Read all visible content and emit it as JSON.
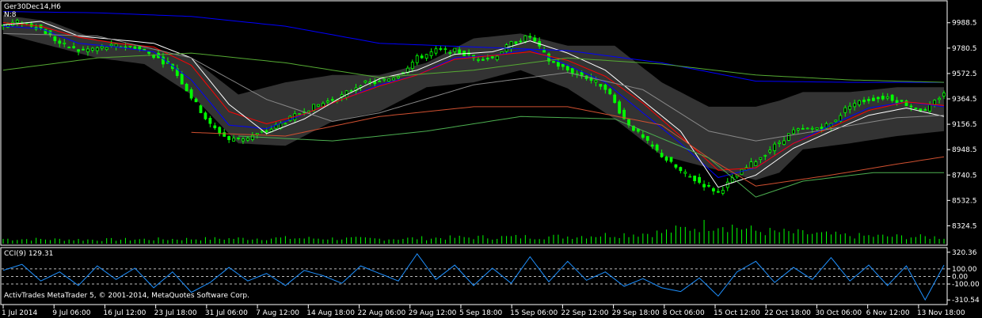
{
  "window": {
    "symbol_period": "Ger30Dec14,H6",
    "n_label": "N:8"
  },
  "footer": {
    "copyright": "ActivTrades MetaTrader 5, © 2001-2014, MetaQuotes Software Corp."
  },
  "colors": {
    "background": "#000000",
    "frame": "#ffffff",
    "candle": "#00ff00",
    "volume": "#00ff00",
    "fast_ma": "#0000ff",
    "red_ma": "#ff0000",
    "white_line": "#ffffff",
    "long_ma": "#1e90ff",
    "band": "#333333",
    "cci_line": "#1e90ff"
  },
  "chart_data": [
    {
      "type": "candlestick",
      "title": "Ger30Dec14,H6",
      "ylim": [
        8230,
        10110
      ],
      "y_tick_labels": [
        "9988.5",
        "9780.5",
        "9572.5",
        "9364.5",
        "9156.5",
        "8948.5",
        "8740.5",
        "8532.5",
        "8324.5"
      ],
      "x_tick_labels": [
        "1 Jul 2014",
        "9 Jul 06:00",
        "16 Jul 12:00",
        "23 Jul 18:00",
        "31 Jul 06:00",
        "7 Aug 12:00",
        "14 Aug 18:00",
        "22 Aug 06:00",
        "29 Aug 12:00",
        "5 Sep 18:00",
        "15 Sep 06:00",
        "22 Sep 12:00",
        "29 Sep 18:00",
        "8 Oct 06:00",
        "15 Oct 12:00",
        "22 Oct 18:00",
        "30 Oct 06:00",
        "6 Nov 12:00",
        "13 Nov 18:00"
      ],
      "close_path": [
        [
          0,
          9970
        ],
        [
          4,
          10000
        ],
        [
          8,
          9940
        ],
        [
          12,
          9820
        ],
        [
          16,
          9760
        ],
        [
          20,
          9780
        ],
        [
          24,
          9800
        ],
        [
          28,
          9790
        ],
        [
          32,
          9720
        ],
        [
          36,
          9620
        ],
        [
          40,
          9380
        ],
        [
          44,
          9150
        ],
        [
          48,
          9030
        ],
        [
          52,
          9050
        ],
        [
          56,
          9100
        ],
        [
          60,
          9180
        ],
        [
          64,
          9270
        ],
        [
          68,
          9330
        ],
        [
          72,
          9390
        ],
        [
          76,
          9490
        ],
        [
          80,
          9500
        ],
        [
          84,
          9560
        ],
        [
          88,
          9700
        ],
        [
          92,
          9760
        ],
        [
          96,
          9760
        ],
        [
          100,
          9700
        ],
        [
          104,
          9700
        ],
        [
          108,
          9820
        ],
        [
          112,
          9880
        ],
        [
          116,
          9680
        ],
        [
          120,
          9600
        ],
        [
          124,
          9540
        ],
        [
          128,
          9460
        ],
        [
          132,
          9200
        ],
        [
          136,
          9040
        ],
        [
          140,
          8900
        ],
        [
          144,
          8770
        ],
        [
          148,
          8680
        ],
        [
          152,
          8600
        ],
        [
          156,
          8740
        ],
        [
          160,
          8860
        ],
        [
          164,
          8980
        ],
        [
          168,
          9100
        ],
        [
          172,
          9120
        ],
        [
          176,
          9160
        ],
        [
          180,
          9320
        ],
        [
          184,
          9360
        ],
        [
          188,
          9380
        ],
        [
          192,
          9320
        ],
        [
          196,
          9260
        ],
        [
          200,
          9420
        ]
      ],
      "volume_path": [
        [
          0,
          6
        ],
        [
          20,
          5
        ],
        [
          40,
          6
        ],
        [
          60,
          7
        ],
        [
          80,
          6
        ],
        [
          100,
          8
        ],
        [
          120,
          9
        ],
        [
          140,
          14
        ],
        [
          148,
          22
        ],
        [
          152,
          26
        ],
        [
          160,
          16
        ],
        [
          180,
          10
        ],
        [
          200,
          8
        ]
      ],
      "series": [
        {
          "name": "fast",
          "path": [
            [
              0,
              9960
            ],
            [
              8,
              9940
            ],
            [
              16,
              9820
            ],
            [
              24,
              9790
            ],
            [
              32,
              9750
            ],
            [
              40,
              9520
            ],
            [
              48,
              9150
            ],
            [
              56,
              9120
            ],
            [
              64,
              9240
            ],
            [
              72,
              9360
            ],
            [
              80,
              9480
            ],
            [
              88,
              9560
            ],
            [
              96,
              9700
            ],
            [
              104,
              9720
            ],
            [
              112,
              9770
            ],
            [
              120,
              9640
            ],
            [
              128,
              9500
            ],
            [
              136,
              9250
            ],
            [
              144,
              9000
            ],
            [
              152,
              8720
            ],
            [
              160,
              8800
            ],
            [
              168,
              9000
            ],
            [
              176,
              9150
            ],
            [
              184,
              9290
            ],
            [
              192,
              9340
            ],
            [
              200,
              9300
            ]
          ]
        },
        {
          "name": "red",
          "path": [
            [
              0,
              9990
            ],
            [
              8,
              9960
            ],
            [
              16,
              9870
            ],
            [
              24,
              9820
            ],
            [
              32,
              9790
            ],
            [
              40,
              9640
            ],
            [
              48,
              9260
            ],
            [
              56,
              9160
            ],
            [
              64,
              9240
            ],
            [
              72,
              9360
            ],
            [
              80,
              9470
            ],
            [
              88,
              9560
            ],
            [
              96,
              9690
            ],
            [
              104,
              9720
            ],
            [
              112,
              9750
            ],
            [
              120,
              9680
            ],
            [
              128,
              9550
            ],
            [
              136,
              9330
            ],
            [
              144,
              9060
            ],
            [
              152,
              8780
            ],
            [
              160,
              8800
            ],
            [
              168,
              9000
            ],
            [
              176,
              9130
            ],
            [
              184,
              9270
            ],
            [
              192,
              9340
            ],
            [
              200,
              9310
            ]
          ]
        },
        {
          "name": "white",
          "path": [
            [
              0,
              9970
            ],
            [
              8,
              10000
            ],
            [
              16,
              9880
            ],
            [
              24,
              9850
            ],
            [
              32,
              9820
            ],
            [
              40,
              9700
            ],
            [
              48,
              9320
            ],
            [
              56,
              9080
            ],
            [
              64,
              9200
            ],
            [
              72,
              9380
            ],
            [
              80,
              9530
            ],
            [
              88,
              9600
            ],
            [
              96,
              9730
            ],
            [
              104,
              9750
            ],
            [
              112,
              9840
            ],
            [
              120,
              9740
            ],
            [
              128,
              9600
            ],
            [
              136,
              9350
            ],
            [
              144,
              9100
            ],
            [
              152,
              8640
            ],
            [
              160,
              8740
            ],
            [
              168,
              8960
            ],
            [
              176,
              9100
            ],
            [
              184,
              9230
            ],
            [
              192,
              9290
            ],
            [
              200,
              9220
            ]
          ]
        },
        {
          "name": "blue_long",
          "path": [
            [
              0,
              10080
            ],
            [
              20,
              10070
            ],
            [
              40,
              10040
            ],
            [
              60,
              9960
            ],
            [
              80,
              9820
            ],
            [
              100,
              9790
            ],
            [
              120,
              9760
            ],
            [
              140,
              9660
            ],
            [
              160,
              9510
            ],
            [
              180,
              9500
            ],
            [
              200,
              9500
            ]
          ]
        },
        {
          "name": "green_long",
          "path": [
            [
              0,
              9600
            ],
            [
              20,
              9700
            ],
            [
              40,
              9740
            ],
            [
              60,
              9660
            ],
            [
              80,
              9540
            ],
            [
              100,
              9600
            ],
            [
              120,
              9700
            ],
            [
              140,
              9650
            ],
            [
              160,
              9560
            ],
            [
              180,
              9520
            ],
            [
              200,
              9500
            ]
          ]
        },
        {
          "name": "gray_mid",
          "path": [
            [
              0,
              9900
            ],
            [
              20,
              9880
            ],
            [
              40,
              9700
            ],
            [
              56,
              9360
            ],
            [
              70,
              9180
            ],
            [
              80,
              9250
            ],
            [
              100,
              9480
            ],
            [
              120,
              9580
            ],
            [
              136,
              9440
            ],
            [
              150,
              9100
            ],
            [
              160,
              9020
            ],
            [
              176,
              9120
            ],
            [
              190,
              9210
            ],
            [
              200,
              9230
            ]
          ]
        },
        {
          "name": "red_long",
          "path": [
            [
              40,
              9090
            ],
            [
              60,
              9060
            ],
            [
              80,
              9220
            ],
            [
              100,
              9300
            ],
            [
              120,
              9300
            ],
            [
              140,
              9150
            ],
            [
              150,
              8880
            ],
            [
              160,
              8650
            ],
            [
              176,
              8740
            ],
            [
              190,
              8830
            ],
            [
              200,
              8890
            ]
          ]
        },
        {
          "name": "green_low",
          "path": [
            [
              50,
              9060
            ],
            [
              70,
              9020
            ],
            [
              90,
              9100
            ],
            [
              110,
              9220
            ],
            [
              130,
              9200
            ],
            [
              150,
              8880
            ],
            [
              160,
              8560
            ],
            [
              170,
              8690
            ],
            [
              185,
              8760
            ],
            [
              200,
              8760
            ]
          ]
        }
      ],
      "band": {
        "upper": [
          [
            0,
            10050
          ],
          [
            10,
            10000
          ],
          [
            20,
            9850
          ],
          [
            30,
            9800
          ],
          [
            40,
            9700
          ],
          [
            50,
            9400
          ],
          [
            60,
            9500
          ],
          [
            70,
            9560
          ],
          [
            80,
            9560
          ],
          [
            90,
            9660
          ],
          [
            100,
            9860
          ],
          [
            110,
            9900
          ],
          [
            120,
            9800
          ],
          [
            130,
            9800
          ],
          [
            140,
            9500
          ],
          [
            150,
            9300
          ],
          [
            160,
            9300
          ],
          [
            165,
            9350
          ],
          [
            170,
            9420
          ],
          [
            180,
            9420
          ],
          [
            190,
            9460
          ],
          [
            200,
            9460
          ]
        ],
        "lower": [
          [
            0,
            9900
          ],
          [
            10,
            9800
          ],
          [
            20,
            9700
          ],
          [
            30,
            9650
          ],
          [
            40,
            9400
          ],
          [
            50,
            9000
          ],
          [
            60,
            8980
          ],
          [
            70,
            9180
          ],
          [
            80,
            9260
          ],
          [
            90,
            9460
          ],
          [
            100,
            9500
          ],
          [
            110,
            9600
          ],
          [
            120,
            9450
          ],
          [
            130,
            9200
          ],
          [
            140,
            8900
          ],
          [
            150,
            8800
          ],
          [
            160,
            8700
          ],
          [
            165,
            8760
          ],
          [
            170,
            8950
          ],
          [
            180,
            9000
          ],
          [
            190,
            9060
          ],
          [
            200,
            9100
          ]
        ]
      }
    },
    {
      "type": "line",
      "title": "CCI(9) 129.31",
      "indicator": "CCI(9)",
      "value": 129.31,
      "ylim": [
        -340,
        350
      ],
      "y_tick_labels": [
        "320.36",
        "100.00",
        "0.00",
        "-100.00",
        "-310.54"
      ],
      "levels": [
        100,
        0,
        -100
      ],
      "path": [
        [
          0,
          80
        ],
        [
          4,
          160
        ],
        [
          8,
          -60
        ],
        [
          12,
          60
        ],
        [
          16,
          -120
        ],
        [
          20,
          140
        ],
        [
          24,
          -40
        ],
        [
          28,
          110
        ],
        [
          32,
          -150
        ],
        [
          36,
          60
        ],
        [
          40,
          -210
        ],
        [
          44,
          -80
        ],
        [
          48,
          120
        ],
        [
          52,
          -60
        ],
        [
          56,
          40
        ],
        [
          60,
          -120
        ],
        [
          64,
          80
        ],
        [
          68,
          10
        ],
        [
          72,
          -90
        ],
        [
          76,
          140
        ],
        [
          80,
          40
        ],
        [
          84,
          -60
        ],
        [
          88,
          300
        ],
        [
          92,
          -40
        ],
        [
          96,
          150
        ],
        [
          100,
          -120
        ],
        [
          104,
          110
        ],
        [
          108,
          -90
        ],
        [
          112,
          260
        ],
        [
          116,
          -70
        ],
        [
          120,
          200
        ],
        [
          124,
          -50
        ],
        [
          128,
          60
        ],
        [
          132,
          -130
        ],
        [
          136,
          -30
        ],
        [
          140,
          -150
        ],
        [
          144,
          -200
        ],
        [
          148,
          -20
        ],
        [
          152,
          -260
        ],
        [
          156,
          60
        ],
        [
          160,
          200
        ],
        [
          164,
          -80
        ],
        [
          168,
          120
        ],
        [
          172,
          -40
        ],
        [
          176,
          250
        ],
        [
          180,
          -60
        ],
        [
          184,
          150
        ],
        [
          188,
          -120
        ],
        [
          192,
          140
        ],
        [
          196,
          -310
        ],
        [
          200,
          150
        ]
      ]
    }
  ]
}
